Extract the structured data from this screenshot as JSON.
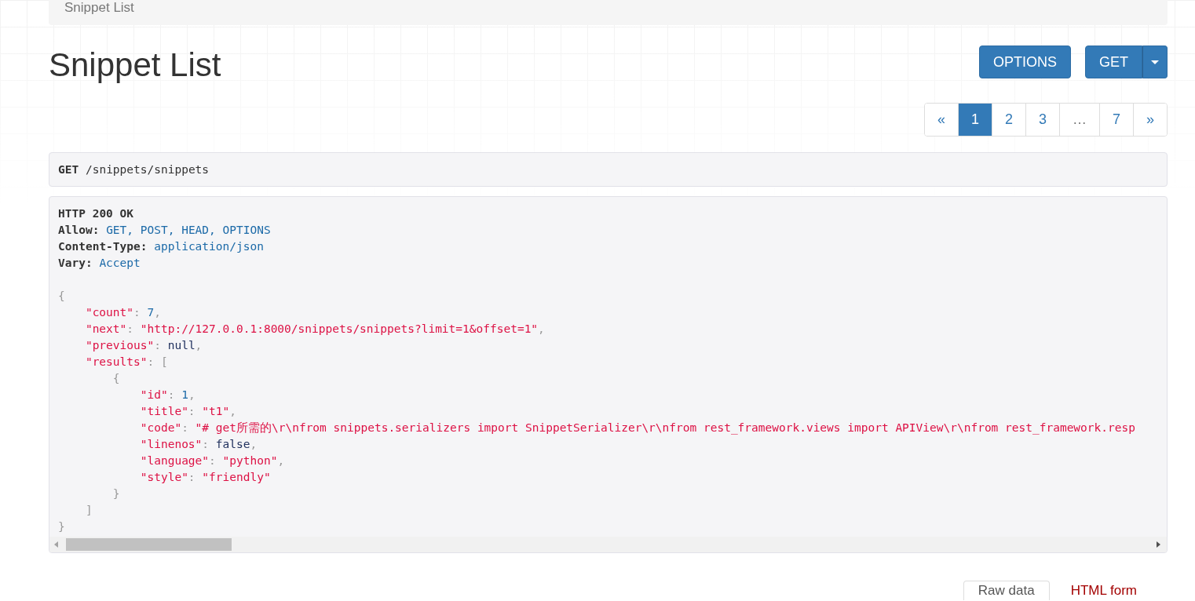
{
  "breadcrumb": {
    "label": "Snippet List"
  },
  "title": "Snippet List",
  "buttons": [
    {
      "label": "OPTIONS",
      "kind": "plain"
    },
    {
      "label": "GET",
      "kind": "split"
    }
  ],
  "pagination": [
    {
      "label": "«",
      "selected": false,
      "disabled": false
    },
    {
      "label": "1",
      "selected": true,
      "disabled": false
    },
    {
      "label": "2",
      "selected": false,
      "disabled": false
    },
    {
      "label": "3",
      "selected": false,
      "disabled": false
    },
    {
      "label": "…",
      "selected": false,
      "disabled": true
    },
    {
      "label": "7",
      "selected": false,
      "disabled": false
    },
    {
      "label": "»",
      "selected": false,
      "disabled": false
    }
  ],
  "request": {
    "method": "GET",
    "path": "/snippets/snippets"
  },
  "response": {
    "status": "HTTP 200 OK",
    "headers": [
      {
        "name": "Allow:",
        "value": "GET, POST, HEAD, OPTIONS"
      },
      {
        "name": "Content-Type:",
        "value": "application/json"
      },
      {
        "name": "Vary:",
        "value": "Accept"
      }
    ],
    "body": [
      {
        "tokens": [
          {
            "kind": "punct",
            "text": "{"
          }
        ],
        "children": [
          {
            "tokens": [
              {
                "kind": "key",
                "text": "\"count\""
              },
              {
                "kind": "punct",
                "text": ": "
              },
              {
                "kind": "number",
                "text": "7"
              },
              {
                "kind": "punct",
                "text": ","
              }
            ]
          },
          {
            "tokens": [
              {
                "kind": "key",
                "text": "\"next\""
              },
              {
                "kind": "punct",
                "text": ": "
              },
              {
                "kind": "string",
                "text": "\"http://127.0.0.1:8000/snippets/snippets?limit=1&offset=1\""
              },
              {
                "kind": "punct",
                "text": ","
              }
            ]
          },
          {
            "tokens": [
              {
                "kind": "key",
                "text": "\"previous\""
              },
              {
                "kind": "punct",
                "text": ": "
              },
              {
                "kind": "literal",
                "text": "null"
              },
              {
                "kind": "punct",
                "text": ","
              }
            ]
          },
          {
            "tokens": [
              {
                "kind": "key",
                "text": "\"results\""
              },
              {
                "kind": "punct",
                "text": ": ["
              }
            ],
            "children": [
              {
                "tokens": [
                  {
                    "kind": "punct",
                    "text": "{"
                  }
                ],
                "children": [
                  {
                    "tokens": [
                      {
                        "kind": "key",
                        "text": "\"id\""
                      },
                      {
                        "kind": "punct",
                        "text": ": "
                      },
                      {
                        "kind": "number",
                        "text": "1"
                      },
                      {
                        "kind": "punct",
                        "text": ","
                      }
                    ]
                  },
                  {
                    "tokens": [
                      {
                        "kind": "key",
                        "text": "\"title\""
                      },
                      {
                        "kind": "punct",
                        "text": ": "
                      },
                      {
                        "kind": "string",
                        "text": "\"t1\""
                      },
                      {
                        "kind": "punct",
                        "text": ","
                      }
                    ]
                  },
                  {
                    "tokens": [
                      {
                        "kind": "key",
                        "text": "\"code\""
                      },
                      {
                        "kind": "punct",
                        "text": ": "
                      },
                      {
                        "kind": "string",
                        "text": "\"# get所需的\\r\\nfrom snippets.serializers import SnippetSerializer\\r\\nfrom rest_framework.views import APIView\\r\\nfrom rest_framework.resp"
                      }
                    ]
                  },
                  {
                    "tokens": [
                      {
                        "kind": "key",
                        "text": "\"linenos\""
                      },
                      {
                        "kind": "punct",
                        "text": ": "
                      },
                      {
                        "kind": "literal",
                        "text": "false"
                      },
                      {
                        "kind": "punct",
                        "text": ","
                      }
                    ]
                  },
                  {
                    "tokens": [
                      {
                        "kind": "key",
                        "text": "\"language\""
                      },
                      {
                        "kind": "punct",
                        "text": ": "
                      },
                      {
                        "kind": "string",
                        "text": "\"python\""
                      },
                      {
                        "kind": "punct",
                        "text": ","
                      }
                    ]
                  },
                  {
                    "tokens": [
                      {
                        "kind": "key",
                        "text": "\"style\""
                      },
                      {
                        "kind": "punct",
                        "text": ": "
                      },
                      {
                        "kind": "string",
                        "text": "\"friendly\""
                      }
                    ]
                  }
                ]
              },
              {
                "tokens": [
                  {
                    "kind": "punct",
                    "text": "}"
                  }
                ]
              }
            ]
          },
          {
            "tokens": [
              {
                "kind": "punct",
                "text": "]"
              }
            ]
          }
        ]
      },
      {
        "tokens": [
          {
            "kind": "punct",
            "text": "}"
          }
        ]
      }
    ]
  },
  "format_tabs": [
    {
      "label": "Raw data",
      "selected": true
    },
    {
      "label": "HTML form",
      "selected": false
    }
  ]
}
